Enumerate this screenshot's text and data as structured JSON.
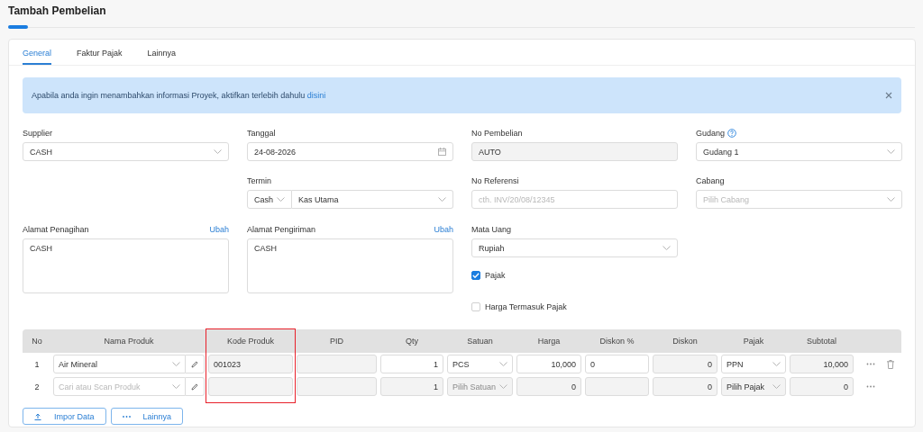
{
  "page": {
    "title": "Tambah Pembelian"
  },
  "tabs": [
    {
      "label": "General",
      "selected": true
    },
    {
      "label": "Faktur Pajak",
      "selected": false
    },
    {
      "label": "Lainnya",
      "selected": false
    }
  ],
  "alert": {
    "text": "Apabila anda ingin menambahkan informasi Proyek, aktifkan terlebih dahulu",
    "link": "disini"
  },
  "form": {
    "columns": [
      [
        {
          "label": "Supplier",
          "kind": "select",
          "value": "CASH"
        },
        {
          "label": "Alamat Penagihan",
          "kind": "textarea",
          "value": "CASH",
          "action": "Ubah"
        }
      ],
      [
        {
          "label": "Tanggal",
          "kind": "date",
          "value": "24-08-2026"
        },
        {
          "label": "Termin",
          "kind": "split",
          "term": "Cash",
          "account": "Kas Utama"
        },
        {
          "label": "Alamat Pengiriman",
          "kind": "textarea",
          "value": "CASH",
          "action": "Ubah"
        }
      ],
      [
        {
          "label": "No Pembelian",
          "kind": "readonly",
          "value": "AUTO"
        },
        {
          "label": "No Referensi",
          "kind": "input",
          "placeholder": "cth. INV/20/08/12345"
        },
        {
          "label": "Mata Uang",
          "kind": "select",
          "value": "Rupiah"
        },
        {
          "label": "Pajak",
          "kind": "checkbox",
          "checked": true
        },
        {
          "label": "Harga Termasuk Pajak",
          "kind": "checkbox",
          "checked": false
        }
      ],
      [
        {
          "label": "Gudang",
          "kind": "select",
          "value": "Gudang 1",
          "help": true
        },
        {
          "label": "Cabang",
          "kind": "select",
          "placeholder": "Pilih Cabang"
        }
      ]
    ]
  },
  "table": {
    "columns": [
      {
        "label": "No",
        "highlighted": false
      },
      {
        "label": "Nama Produk",
        "highlighted": false
      },
      {
        "label": "Kode Produk",
        "highlighted": true
      },
      {
        "label": "PID",
        "highlighted": false
      },
      {
        "label": "Qty",
        "highlighted": false
      },
      {
        "label": "Satuan",
        "highlighted": false
      },
      {
        "label": "Harga",
        "highlighted": false
      },
      {
        "label": "Diskon %",
        "highlighted": false
      },
      {
        "label": "Diskon",
        "highlighted": false
      },
      {
        "label": "Pajak",
        "highlighted": false
      },
      {
        "label": "Subtotal",
        "highlighted": false
      }
    ],
    "rows": [
      {
        "no": "1",
        "deletable": true,
        "cells": [
          {
            "kind": "product",
            "value": "Air Mineral"
          },
          {
            "kind": "readonly-text",
            "value": "001023"
          },
          {
            "kind": "readonly-text"
          },
          {
            "kind": "input-number",
            "value": "1"
          },
          {
            "kind": "select",
            "value": "PCS",
            "disabled": false
          },
          {
            "kind": "input-number",
            "value": "10,000"
          },
          {
            "kind": "input-text",
            "value": "0"
          },
          {
            "kind": "readonly-number",
            "value": "0"
          },
          {
            "kind": "select",
            "value": "PPN",
            "disabled": false
          },
          {
            "kind": "readonly-number",
            "value": "10,000"
          }
        ]
      },
      {
        "no": "2",
        "deletable": false,
        "cells": [
          {
            "kind": "product",
            "placeholder": "Cari atau Scan Produk"
          },
          {
            "kind": "readonly-text"
          },
          {
            "kind": "readonly-text"
          },
          {
            "kind": "readonly-number",
            "value": "1"
          },
          {
            "kind": "select",
            "placeholder": "Pilih Satuan",
            "disabled": true
          },
          {
            "kind": "readonly-number",
            "value": "0"
          },
          {
            "kind": "readonly-text"
          },
          {
            "kind": "readonly-number",
            "value": "0"
          },
          {
            "kind": "select",
            "value": "Pilih Pajak",
            "disabled": true
          },
          {
            "kind": "readonly-number",
            "value": "0"
          }
        ]
      }
    ]
  },
  "buttons": [
    {
      "label": "Impor Data"
    },
    {
      "label": "Lainnya"
    }
  ]
}
